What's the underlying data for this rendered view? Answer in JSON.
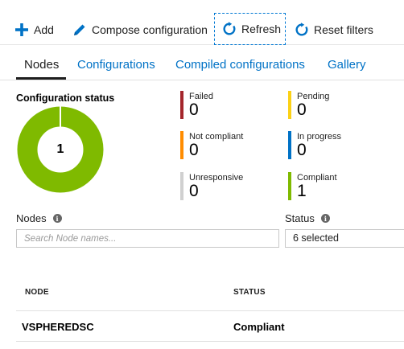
{
  "toolbar": {
    "add": {
      "label": "Add",
      "icon": "plus-icon"
    },
    "compose": {
      "label": "Compose configuration",
      "icon": "pencil-icon"
    },
    "refresh": {
      "label": "Refresh",
      "icon": "refresh-icon"
    },
    "reset": {
      "label": "Reset filters",
      "icon": "refresh-icon"
    }
  },
  "tabs": [
    {
      "label": "Nodes",
      "active": true
    },
    {
      "label": "Configurations",
      "active": false
    },
    {
      "label": "Compiled configurations",
      "active": false
    },
    {
      "label": "Gallery",
      "active": false
    }
  ],
  "status": {
    "title": "Configuration status",
    "total": "1",
    "donut_color": "#7fba00",
    "items": [
      {
        "label": "Failed",
        "value": "0",
        "color": "#a4262c"
      },
      {
        "label": "Pending",
        "value": "0",
        "color": "#fcd116"
      },
      {
        "label": "Not compliant",
        "value": "0",
        "color": "#ff8c00"
      },
      {
        "label": "In progress",
        "value": "0",
        "color": "#0072c6"
      },
      {
        "label": "Unresponsive",
        "value": "0",
        "color": "#d0d0d0"
      },
      {
        "label": "Compliant",
        "value": "1",
        "color": "#7fba00"
      }
    ]
  },
  "filters": {
    "nodes_label": "Nodes",
    "search_placeholder": "Search Node names...",
    "status_label": "Status",
    "status_value": "6 selected"
  },
  "table": {
    "headers": [
      "NODE",
      "STATUS"
    ],
    "rows": [
      {
        "node": "VSPHEREDSC",
        "status": "Compliant"
      }
    ]
  }
}
